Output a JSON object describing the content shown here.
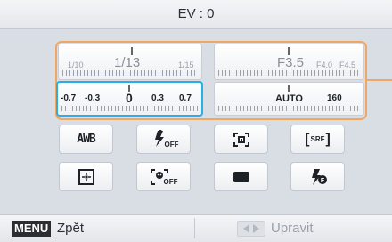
{
  "header": {
    "title": "EV : 0"
  },
  "shutter": {
    "left_value": "1/10",
    "current_value": "1/13",
    "right_value": "1/15"
  },
  "aperture": {
    "current_value": "F3.5",
    "next_value_1": "F4.0",
    "next_value_2": "F4.5"
  },
  "ev_scale": {
    "values": [
      "-0.7",
      "-0.3",
      "0",
      "0.3",
      "0.7"
    ],
    "selected_value": "0"
  },
  "iso": {
    "current_value": "AUTO",
    "next_value": "160"
  },
  "buttons": [
    {
      "name": "white-balance",
      "icon": "awb-icon",
      "label": "AWB"
    },
    {
      "name": "flash-off",
      "icon": "flash-off-icon",
      "label": "OFF"
    },
    {
      "name": "metering",
      "icon": "metering-icon"
    },
    {
      "name": "srf",
      "icon": "srf-icon",
      "label": "SRF"
    },
    {
      "name": "focus-area",
      "icon": "focus-area-icon"
    },
    {
      "name": "face-detect-off",
      "icon": "face-detect-off-icon",
      "label": "OFF"
    },
    {
      "name": "aspect",
      "icon": "rectangle-icon"
    },
    {
      "name": "flash",
      "icon": "flash-icon"
    }
  ],
  "footer": {
    "menu_key": "MENU",
    "back_label": "Zpět",
    "edit_label": "Upravit"
  },
  "colors": {
    "highlight_frame": "#f0a763",
    "selected_border": "#29aee6"
  }
}
